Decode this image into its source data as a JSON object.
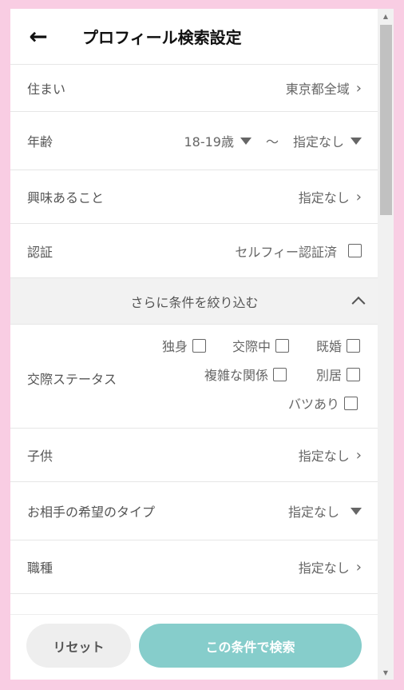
{
  "header": {
    "back_icon": "←",
    "title": "プロフィール検索設定"
  },
  "rows": {
    "residence": {
      "label": "住まい",
      "value": "東京都全域"
    },
    "age": {
      "label": "年齢",
      "min": "18-19歳",
      "separator": "〜",
      "max": "指定なし"
    },
    "interests": {
      "label": "興味あること",
      "value": "指定なし"
    },
    "verification": {
      "label": "認証",
      "option": "セルフィー認証済"
    },
    "refine": {
      "label": "さらに条件を絞り込む"
    },
    "relationship": {
      "label": "交際ステータス",
      "options": [
        "独身",
        "交際中",
        "既婚",
        "複雑な関係",
        "別居",
        "バツあり"
      ]
    },
    "children": {
      "label": "子供",
      "value": "指定なし"
    },
    "partner_type": {
      "label": "お相手の希望のタイプ",
      "value": "指定なし"
    },
    "occupation": {
      "label": "職種",
      "value": "指定なし"
    }
  },
  "footer": {
    "reset_label": "リセット",
    "search_label": "この条件で検索"
  },
  "colors": {
    "background": "#f9cde3",
    "search_button": "#86cdcb",
    "reset_button": "#eeeeee",
    "section_bg": "#f2f2f2"
  }
}
